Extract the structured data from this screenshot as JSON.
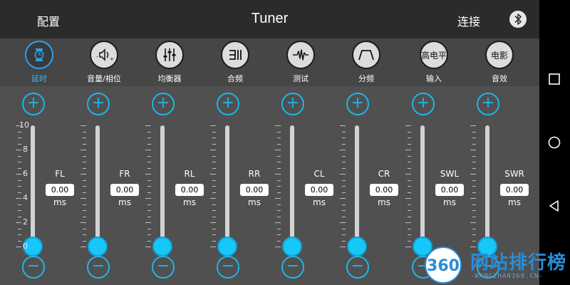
{
  "header": {
    "config_label": "配置",
    "title": "Tuner",
    "connect_label": "连接",
    "bluetooth_icon": "bluetooth-icon"
  },
  "tabs": [
    {
      "label": "延时",
      "icon": "delay-timer-icon",
      "active": true
    },
    {
      "label": "音量/相位",
      "icon": "volume-phase-icon",
      "active": false
    },
    {
      "label": "均衡器",
      "icon": "equalizer-icon",
      "active": false
    },
    {
      "label": "合频",
      "icon": "crossover-merge-icon",
      "active": false
    },
    {
      "label": "测试",
      "icon": "test-waveform-icon",
      "active": false
    },
    {
      "label": "分频",
      "icon": "frequency-divider-icon",
      "active": false
    },
    {
      "label": "输入",
      "icon_text": "高电平",
      "active": false
    },
    {
      "label": "音效",
      "icon_text": "电影",
      "active": false
    }
  ],
  "scale": {
    "ticks": [
      "10",
      "8",
      "6",
      "4",
      "2",
      "0"
    ]
  },
  "channels": [
    {
      "name": "FL",
      "value": "0.00",
      "unit": "ms",
      "level": 0
    },
    {
      "name": "FR",
      "value": "0.00",
      "unit": "ms",
      "level": 0
    },
    {
      "name": "RL",
      "value": "0.00",
      "unit": "ms",
      "level": 0
    },
    {
      "name": "RR",
      "value": "0.00",
      "unit": "ms",
      "level": 0
    },
    {
      "name": "CL",
      "value": "0.00",
      "unit": "ms",
      "level": 0
    },
    {
      "name": "CR",
      "value": "0.00",
      "unit": "ms",
      "level": 0
    },
    {
      "name": "SWL",
      "value": "0.00",
      "unit": "ms",
      "level": 0
    },
    {
      "name": "SWR",
      "value": "0.00",
      "unit": "ms",
      "level": 0
    }
  ],
  "buttons": {
    "plus": "+",
    "minus": "−"
  },
  "watermark": {
    "logo": "360",
    "text": "网站排行榜",
    "sub": "-WANGZHAN360.CN-"
  },
  "colors": {
    "accent": "#1fb5e8",
    "thumb": "#17c7f7",
    "active_tab": "#39b6f3",
    "header_bg": "#2b2b2b",
    "panel_bg": "#505050"
  }
}
